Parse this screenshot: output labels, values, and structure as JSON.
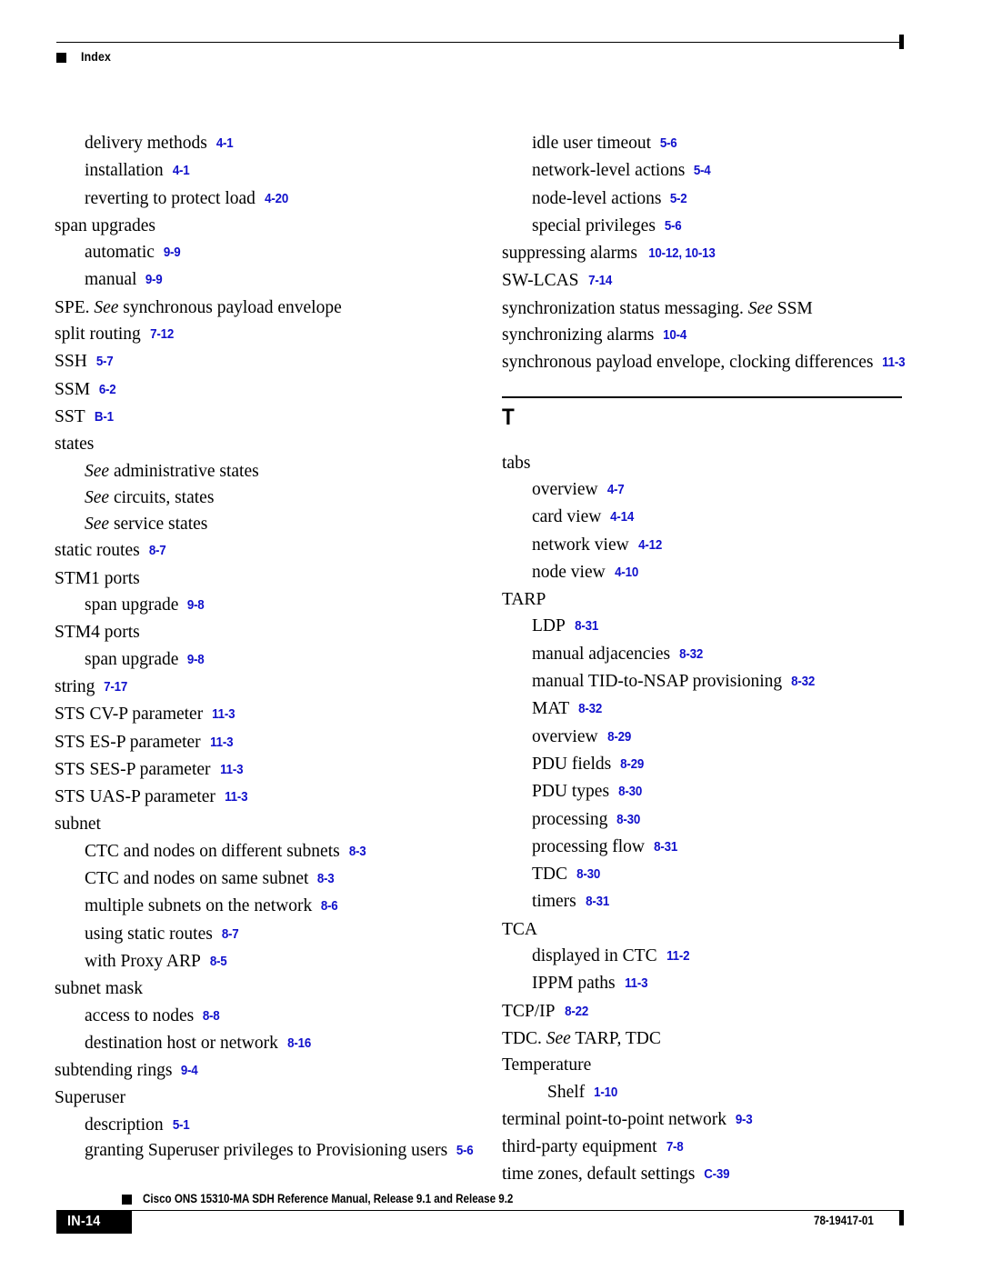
{
  "header": {
    "label": "Index",
    "marker_icon": "black-square-icon"
  },
  "colors": {
    "link_blue": "#1111cc",
    "text_black": "#000000",
    "page_background": "#ffffff"
  },
  "columns": {
    "left": [
      {
        "level": 2,
        "term": "delivery methods",
        "page": "4-1"
      },
      {
        "level": 2,
        "term": "installation",
        "page": "4-1"
      },
      {
        "level": 2,
        "term": "reverting to protect load",
        "page": "4-20"
      },
      {
        "level": 1,
        "term": "span upgrades",
        "page": ""
      },
      {
        "level": 2,
        "term": "automatic",
        "page": "9-9"
      },
      {
        "level": 2,
        "term": "manual",
        "page": "9-9"
      },
      {
        "level": 1,
        "term": "SPE. ",
        "see": "See",
        "term_after": " synchronous payload envelope",
        "page": ""
      },
      {
        "level": 1,
        "term": "split routing",
        "page": "7-12"
      },
      {
        "level": 1,
        "term": "SSH",
        "page": "5-7"
      },
      {
        "level": 1,
        "term": "SSM",
        "page": "6-2"
      },
      {
        "level": 1,
        "term": "SST",
        "page": "B-1"
      },
      {
        "level": 1,
        "term": "states",
        "page": ""
      },
      {
        "level": 2,
        "term": "",
        "see": "See",
        "term_after": " administrative states",
        "page": ""
      },
      {
        "level": 2,
        "term": "",
        "see": "See",
        "term_after": "  circuits, states",
        "page": ""
      },
      {
        "level": 2,
        "term": "",
        "see": "See",
        "term_after": " service states",
        "page": ""
      },
      {
        "level": 1,
        "term": "static routes",
        "page": "8-7"
      },
      {
        "level": 1,
        "term": "STM1 ports",
        "page": ""
      },
      {
        "level": 2,
        "term": "span upgrade",
        "page": "9-8"
      },
      {
        "level": 1,
        "term": "STM4 ports",
        "page": ""
      },
      {
        "level": 2,
        "term": "span upgrade",
        "page": "9-8"
      },
      {
        "level": 1,
        "term": "string",
        "page": "7-17"
      },
      {
        "level": 1,
        "term": "STS CV-P parameter",
        "page": "11-3"
      },
      {
        "level": 1,
        "term": "STS ES-P parameter",
        "page": "11-3"
      },
      {
        "level": 1,
        "term": "STS SES-P parameter",
        "page": "11-3"
      },
      {
        "level": 1,
        "term": "STS UAS-P parameter",
        "page": "11-3"
      },
      {
        "level": 1,
        "term": "subnet",
        "page": ""
      },
      {
        "level": 2,
        "term": "CTC and nodes on different subnets",
        "page": "8-3"
      },
      {
        "level": 2,
        "term": "CTC and nodes on same subnet",
        "page": "8-3"
      },
      {
        "level": 2,
        "term": "multiple subnets on the network",
        "page": "8-6"
      },
      {
        "level": 2,
        "term": "using static routes",
        "page": "8-7"
      },
      {
        "level": 2,
        "term": "with Proxy ARP",
        "page": "8-5"
      },
      {
        "level": 1,
        "term": "subnet mask",
        "page": ""
      },
      {
        "level": 2,
        "term": "access to nodes",
        "page": "8-8"
      },
      {
        "level": 2,
        "term": "destination host or network",
        "page": "8-16"
      },
      {
        "level": 1,
        "term": "subtending rings",
        "page": "9-4"
      },
      {
        "level": 1,
        "term": "Superuser",
        "page": ""
      },
      {
        "level": 2,
        "term": "description",
        "page": "5-1"
      },
      {
        "level": 2,
        "term": "granting Superuser privileges to Provisioning users",
        "page": "5-6",
        "wrap": true
      }
    ],
    "right_top": [
      {
        "level": 2,
        "term": "idle user timeout",
        "page": "5-6"
      },
      {
        "level": 2,
        "term": "network-level actions",
        "page": "5-4"
      },
      {
        "level": 2,
        "term": "node-level actions",
        "page": "5-2"
      },
      {
        "level": 2,
        "term": "special privileges",
        "page": "5-6"
      },
      {
        "level": 1,
        "term": "suppressing alarms",
        "page": "10-12, 10-13"
      },
      {
        "level": 1,
        "term": "SW-LCAS",
        "page": "7-14"
      },
      {
        "level": 1,
        "term": "synchronization status messaging. ",
        "see": "See",
        "term_after": " SSM",
        "page": ""
      },
      {
        "level": 1,
        "term": "synchronizing alarms",
        "page": "10-4"
      },
      {
        "level": 1,
        "term": "synchronous payload envelope, clocking differences",
        "page": "11-3"
      }
    ],
    "section_letter": "T",
    "right_bottom": [
      {
        "level": 1,
        "term": "tabs",
        "page": ""
      },
      {
        "level": 2,
        "term": "overview",
        "page": "4-7"
      },
      {
        "level": 2,
        "term": "card view",
        "page": "4-14"
      },
      {
        "level": 2,
        "term": "network view",
        "page": "4-12"
      },
      {
        "level": 2,
        "term": "node view",
        "page": "4-10"
      },
      {
        "level": 1,
        "term": "TARP",
        "page": ""
      },
      {
        "level": 2,
        "term": "LDP",
        "page": "8-31"
      },
      {
        "level": 2,
        "term": "manual adjacencies",
        "page": "8-32"
      },
      {
        "level": 2,
        "term": "manual TID-to-NSAP provisioning",
        "page": "8-32"
      },
      {
        "level": 2,
        "term": "MAT",
        "page": "8-32"
      },
      {
        "level": 2,
        "term": "overview",
        "page": "8-29"
      },
      {
        "level": 2,
        "term": "PDU fields",
        "page": "8-29"
      },
      {
        "level": 2,
        "term": "PDU types",
        "page": "8-30"
      },
      {
        "level": 2,
        "term": "processing",
        "page": "8-30"
      },
      {
        "level": 2,
        "term": "processing flow",
        "page": "8-31"
      },
      {
        "level": 2,
        "term": "TDC",
        "page": "8-30"
      },
      {
        "level": 2,
        "term": "timers",
        "page": "8-31"
      },
      {
        "level": 1,
        "term": "TCA",
        "page": ""
      },
      {
        "level": 2,
        "term": "displayed in CTC",
        "page": "11-2"
      },
      {
        "level": 2,
        "term": "IPPM paths",
        "page": "11-3"
      },
      {
        "level": 1,
        "term": "TCP/IP",
        "page": "8-22"
      },
      {
        "level": 1,
        "term": "TDC. ",
        "see": "See",
        "term_after": " TARP, TDC",
        "page": ""
      },
      {
        "level": 1,
        "term": "Temperature",
        "page": ""
      },
      {
        "level": 3,
        "term": "Shelf",
        "page": "1-10"
      },
      {
        "level": 1,
        "term": "terminal point-to-point network",
        "page": "9-3"
      },
      {
        "level": 1,
        "term": "third-party equipment",
        "page": "7-8"
      },
      {
        "level": 1,
        "term": "time zones, default settings",
        "page": "C-39"
      }
    ]
  },
  "footer": {
    "page_tab": "IN-14",
    "title": "Cisco ONS 15310-MA SDH Reference Manual, Release 9.1 and Release 9.2",
    "doc_number": "78-19417-01",
    "marker_icon": "black-square-icon"
  }
}
